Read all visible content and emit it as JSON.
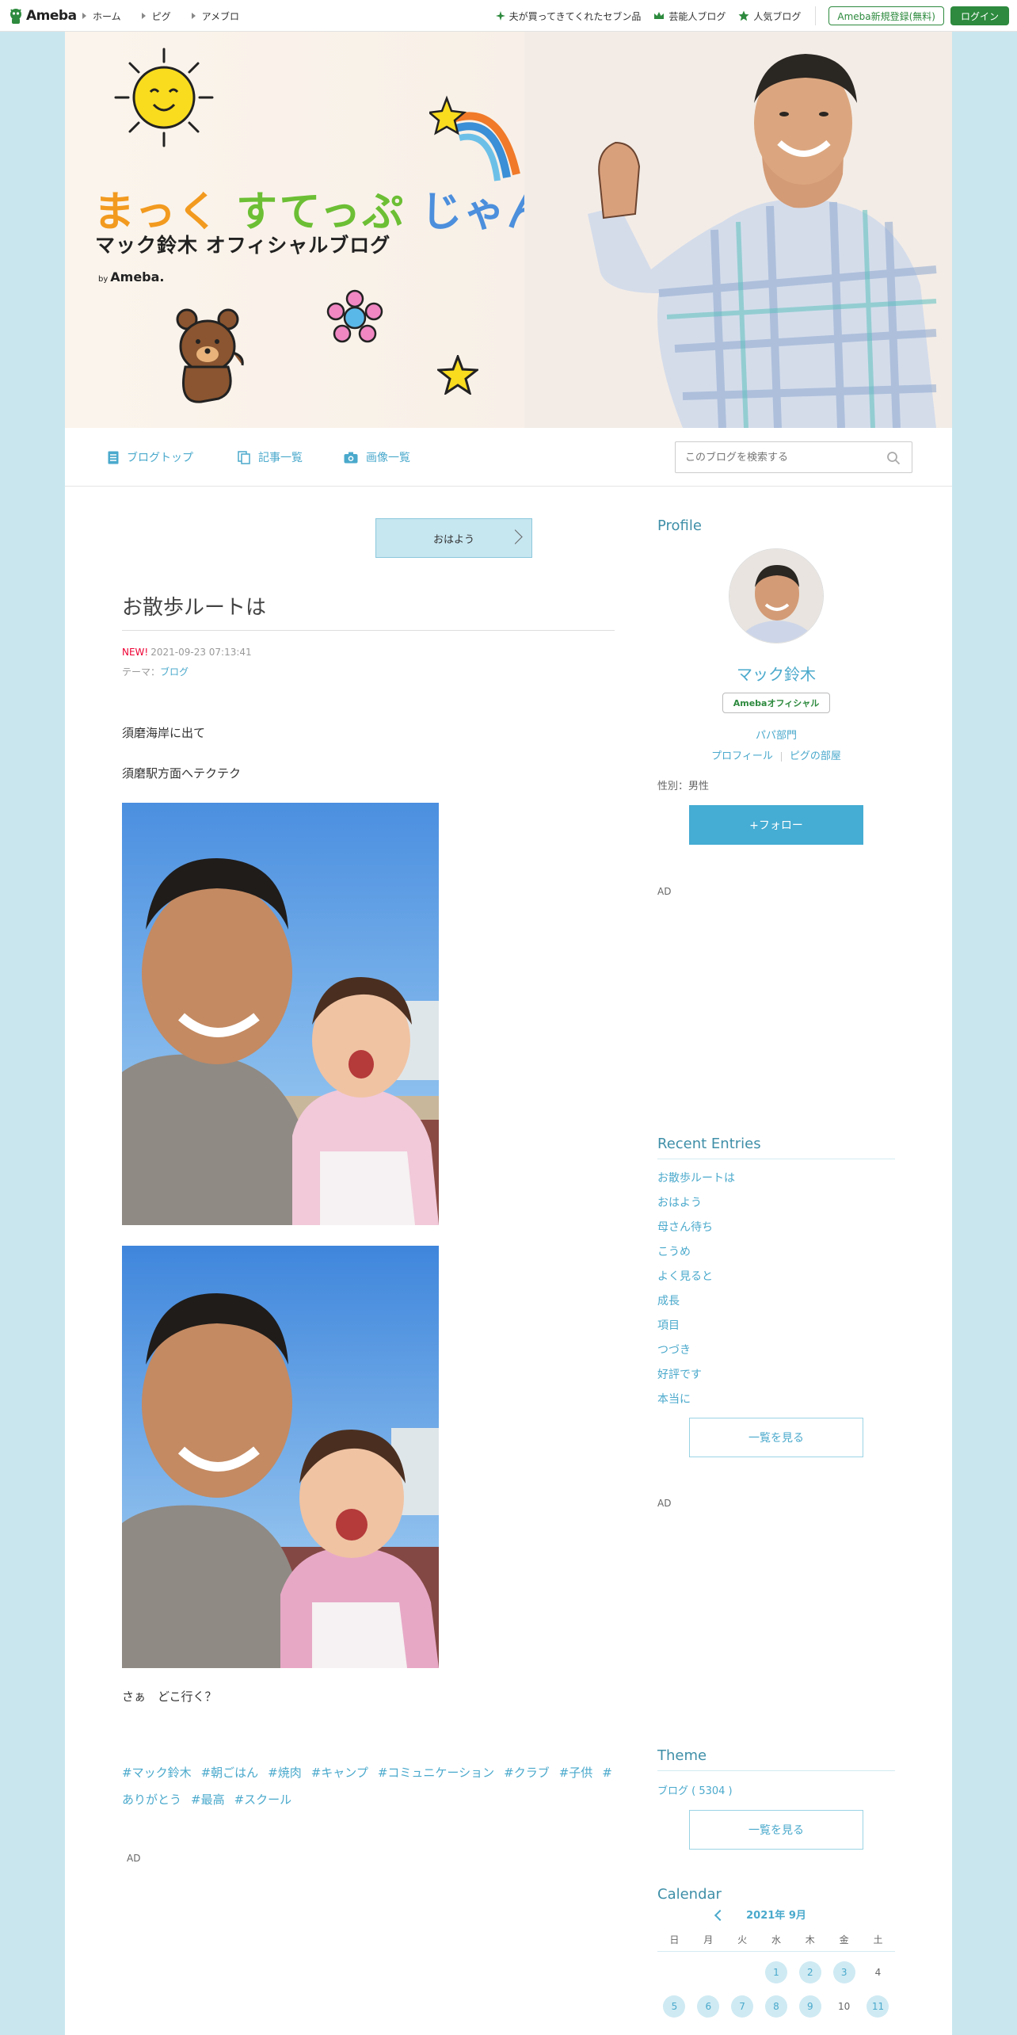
{
  "topbar": {
    "logo_text": "Ameba",
    "nav": [
      "ホーム",
      "ピグ",
      "アメブロ"
    ],
    "right_links": [
      {
        "icon": "sparkle-icon",
        "label": "夫が買ってきてくれたセブン品"
      },
      {
        "icon": "crown-icon",
        "label": "芸能人ブログ"
      },
      {
        "icon": "star-icon",
        "label": "人気ブログ"
      }
    ],
    "register_label": "Ameba新規登録(無料)",
    "login_label": "ログイン",
    "brand_color": "#2d8a3e"
  },
  "header": {
    "title_part1": "まっく",
    "title_part2": "すてっぷ",
    "title_part3": "じゃんぷ",
    "subtitle": "マック鈴木 オフィシャルブログ",
    "by_prefix": "by",
    "by_brand": "Ameba."
  },
  "blog_nav": {
    "items": [
      "ブログトップ",
      "記事一覧",
      "画像一覧"
    ],
    "search_placeholder": "このブログを検索する"
  },
  "entry": {
    "next_entry_label": "おはよう",
    "title": "お散歩ルートは",
    "new_badge": "NEW!",
    "date": "2021-09-23 07:13:41",
    "theme_prefix": "テーマ：",
    "theme": "ブログ",
    "paragraphs": [
      "須磨海岸に出て",
      "須磨駅方面へテクテク",
      "さぁ　どこ行く？"
    ],
    "hashtags": [
      "#マック鈴木",
      "#朝ごはん",
      "#焼肉",
      "#キャンプ",
      "#コミュニケーション",
      "#クラブ",
      "#子供",
      "#ありがとう",
      "#最高",
      "#スクール"
    ],
    "ad_label": "AD"
  },
  "sidebar": {
    "profile_heading": "Profile",
    "name": "マック鈴木",
    "official_badge": "Amebaオフィシャル",
    "category": "パパ部門",
    "link_profile": "プロフィール",
    "link_pigg": "ピグの部屋",
    "gender": "性別：男性",
    "follow_label": "+フォロー",
    "ad1": "AD",
    "recent_heading": "Recent Entries",
    "recent": [
      "お散歩ルートは",
      "おはよう",
      "母さん待ち",
      "こうめ",
      "よく見ると",
      "成長",
      "項目",
      "つづき",
      "好評です",
      "本当に"
    ],
    "recent_more": "一覧を見る",
    "ad2": "AD",
    "theme_heading": "Theme",
    "theme_item": "ブログ ( 5304 )",
    "theme_more": "一覧を見る",
    "calendar_heading": "Calendar",
    "calendar_month": "2021年 9月",
    "weekdays": [
      "日",
      "月",
      "火",
      "水",
      "木",
      "金",
      "土"
    ],
    "week1": [
      "",
      "",
      "",
      "1",
      "2",
      "3",
      "4"
    ],
    "week2": [
      "5",
      "6",
      "7",
      "8",
      "9",
      "10",
      "11"
    ],
    "linked_days": [
      "1",
      "2",
      "3",
      "5",
      "6",
      "7",
      "8",
      "9",
      "11"
    ]
  },
  "colors": {
    "background": "#c9e6ef",
    "link": "#4aa9cc",
    "follow_button": "#45acd3"
  }
}
